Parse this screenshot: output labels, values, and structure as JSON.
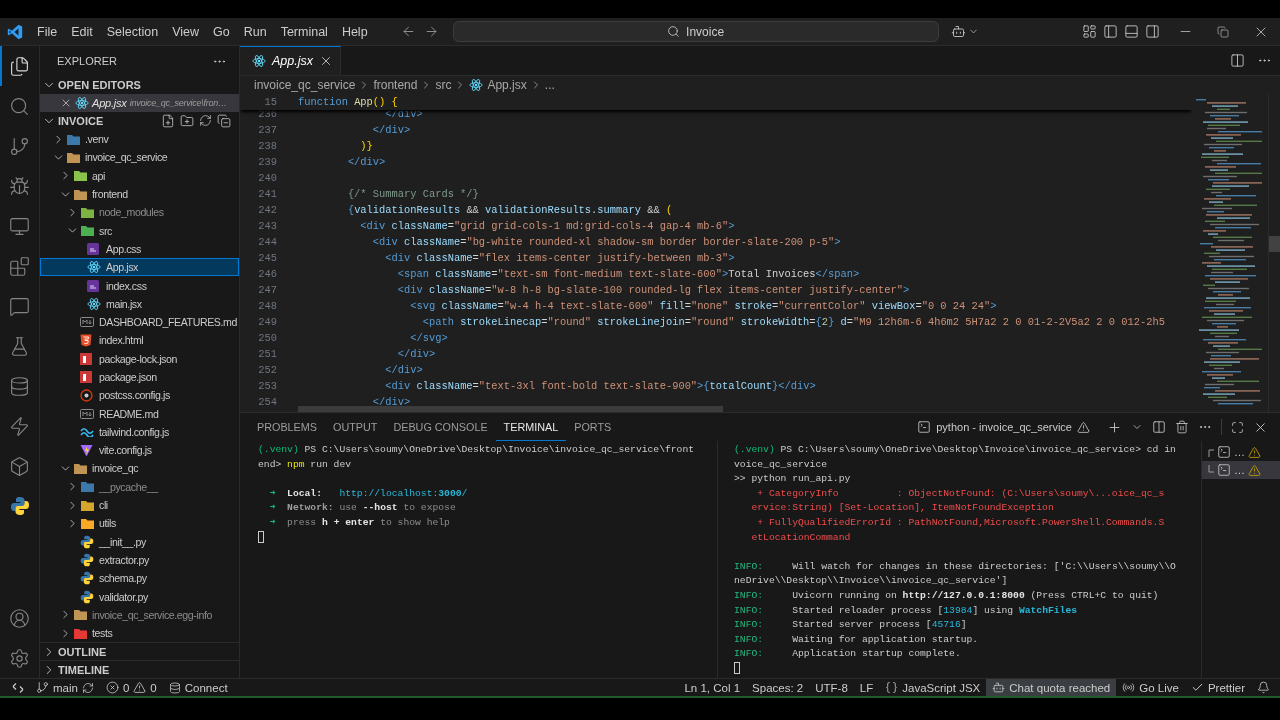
{
  "title_bar": {
    "menu": [
      "File",
      "Edit",
      "Selection",
      "View",
      "Go",
      "Run",
      "Terminal",
      "Help"
    ],
    "search": "Invoice"
  },
  "activity_bar": {
    "items": [
      {
        "kind": "explorer",
        "selected": true
      },
      {
        "kind": "search",
        "selected": false
      },
      {
        "kind": "source-control",
        "selected": false
      },
      {
        "kind": "run-debug",
        "selected": false
      },
      {
        "kind": "remote",
        "selected": false
      },
      {
        "kind": "extensions",
        "selected": false
      },
      {
        "kind": "chat",
        "selected": false
      },
      {
        "kind": "testing",
        "selected": false
      },
      {
        "kind": "database",
        "selected": false
      },
      {
        "kind": "lightning",
        "selected": false
      },
      {
        "kind": "package",
        "selected": false
      },
      {
        "kind": "python",
        "selected": false
      }
    ],
    "bottom": [
      {
        "kind": "account",
        "selected": false
      },
      {
        "kind": "settings",
        "selected": false
      }
    ]
  },
  "sidebar": {
    "title": "EXPLORER",
    "open_editors": {
      "title": "OPEN EDITORS",
      "expanded": true,
      "items": [
        {
          "name": "App.jsx",
          "description": "invoice_qc_service\\fron…",
          "kind": "react",
          "selected": true
        }
      ]
    },
    "workspace": {
      "title": "INVOICE",
      "expanded": true,
      "tree": [
        {
          "name": ".venv",
          "kind": "folder-python",
          "expanded": false,
          "selected": false,
          "ignored": false
        },
        {
          "name": "invoice_qc_service",
          "kind": "folder",
          "expanded": true,
          "selected": false,
          "ignored": false,
          "children": [
            {
              "name": "api",
              "kind": "folder-api",
              "expanded": false,
              "selected": false,
              "ignored": false
            },
            {
              "name": "frontend",
              "kind": "folder",
              "expanded": true,
              "selected": false,
              "ignored": false,
              "children": [
                {
                  "name": "node_modules",
                  "kind": "folder-node",
                  "expanded": false,
                  "selected": false,
                  "ignored": true
                },
                {
                  "name": "src",
                  "kind": "folder-src",
                  "expanded": true,
                  "selected": false,
                  "ignored": false,
                  "children": [
                    {
                      "name": "App.css",
                      "kind": "css",
                      "selected": false,
                      "ignored": false
                    },
                    {
                      "name": "App.jsx",
                      "kind": "react",
                      "selected": true,
                      "ignored": false
                    },
                    {
                      "name": "index.css",
                      "kind": "css",
                      "selected": false,
                      "ignored": false
                    },
                    {
                      "name": "main.jsx",
                      "kind": "react",
                      "selected": false,
                      "ignored": false
                    }
                  ]
                },
                {
                  "name": "DASHBOARD_FEATURES.md",
                  "kind": "markdown",
                  "selected": false,
                  "ignored": false
                },
                {
                  "name": "index.html",
                  "kind": "html",
                  "selected": false,
                  "ignored": false
                },
                {
                  "name": "package-lock.json",
                  "kind": "npm",
                  "selected": false,
                  "ignored": false
                },
                {
                  "name": "package.json",
                  "kind": "npm",
                  "selected": false,
                  "ignored": false
                },
                {
                  "name": "postcss.config.js",
                  "kind": "postcss",
                  "selected": false,
                  "ignored": false
                },
                {
                  "name": "README.md",
                  "kind": "markdown",
                  "selected": false,
                  "ignored": false
                },
                {
                  "name": "tailwind.config.js",
                  "kind": "tailwind",
                  "selected": false,
                  "ignored": false
                },
                {
                  "name": "vite.config.js",
                  "kind": "vite",
                  "selected": false,
                  "ignored": false
                }
              ]
            },
            {
              "name": "invoice_qc",
              "kind": "folder",
              "expanded": true,
              "selected": false,
              "ignored": false,
              "children": [
                {
                  "name": "__pycache__",
                  "kind": "folder-python",
                  "expanded": false,
                  "selected": false,
                  "ignored": true
                },
                {
                  "name": "cli",
                  "kind": "folder-cli",
                  "expanded": false,
                  "selected": false,
                  "ignored": false
                },
                {
                  "name": "utils",
                  "kind": "folder-utils",
                  "expanded": false,
                  "selected": false,
                  "ignored": false
                },
                {
                  "name": "__init__.py",
                  "kind": "python",
                  "selected": false,
                  "ignored": false
                },
                {
                  "name": "extractor.py",
                  "kind": "python",
                  "selected": false,
                  "ignored": false
                },
                {
                  "name": "schema.py",
                  "kind": "python",
                  "selected": false,
                  "ignored": false
                },
                {
                  "name": "validator.py",
                  "kind": "python",
                  "selected": false,
                  "ignored": false
                }
              ]
            },
            {
              "name": "invoice_qc_service.egg-info",
              "kind": "folder",
              "expanded": false,
              "selected": false,
              "ignored": true
            },
            {
              "name": "tests",
              "kind": "folder-test",
              "expanded": false,
              "selected": false,
              "ignored": false
            }
          ]
        }
      ]
    },
    "outline": {
      "title": "OUTLINE",
      "expanded": false
    },
    "timeline": {
      "title": "TIMELINE",
      "expanded": false
    }
  },
  "editor": {
    "tabs": [
      {
        "label": "App.jsx",
        "kind": "react",
        "selected": true,
        "preview": true
      }
    ],
    "breadcrumb": [
      {
        "label": "invoice_qc_service",
        "kind": "folder"
      },
      {
        "label": "frontend",
        "kind": "folder"
      },
      {
        "label": "src",
        "kind": "folder"
      },
      {
        "label": "App.jsx",
        "kind": "react"
      },
      {
        "label": "...",
        "kind": "symbol"
      }
    ],
    "sticky_line": {
      "number": "15",
      "tokens": [
        {
          "text": "function ",
          "kind": "keyword"
        },
        {
          "text": "App",
          "kind": "function"
        },
        {
          "text": "() {",
          "kind": "bracket"
        }
      ]
    },
    "lines": [
      {
        "number": "236",
        "tokens": [
          {
            "text": "              </div>",
            "kind": "tag"
          }
        ]
      },
      {
        "number": "237",
        "tokens": [
          {
            "text": "            </div>",
            "kind": "tag"
          }
        ]
      },
      {
        "number": "238",
        "tokens": [
          {
            "text": "          )}",
            "kind": "bracket"
          }
        ]
      },
      {
        "number": "239",
        "tokens": [
          {
            "text": "        </div>",
            "kind": "tag"
          }
        ]
      },
      {
        "number": "240"
      },
      {
        "number": "241",
        "tokens": [
          {
            "text": "        {/* Summary Cards */}",
            "kind": "comment"
          }
        ]
      },
      {
        "number": "242",
        "tokens": [
          {
            "text": "        {",
            "kind": "brace"
          },
          {
            "text": "validationResults",
            "kind": "variable"
          },
          {
            "text": " && ",
            "kind": "text"
          },
          {
            "text": "validationResults",
            "kind": "variable"
          },
          {
            "text": ".",
            "kind": "text"
          },
          {
            "text": "summary",
            "kind": "variable"
          },
          {
            "text": " && ",
            "kind": "text"
          },
          {
            "text": "(",
            "kind": "bracket"
          }
        ]
      },
      {
        "number": "243",
        "tokens": [
          {
            "text": "          <div",
            "kind": "tag"
          },
          {
            "text": " className",
            "kind": "attr"
          },
          {
            "text": "=",
            "kind": "text"
          },
          {
            "text": "\"grid grid-cols-1 md:grid-cols-4 gap-4 mb-6\"",
            "kind": "string"
          },
          {
            "text": ">",
            "kind": "tag"
          }
        ]
      },
      {
        "number": "244",
        "tokens": [
          {
            "text": "            <div",
            "kind": "tag"
          },
          {
            "text": " className",
            "kind": "attr"
          },
          {
            "text": "=",
            "kind": "text"
          },
          {
            "text": "\"bg-white rounded-xl shadow-sm border border-slate-200 p-5\"",
            "kind": "string"
          },
          {
            "text": ">",
            "kind": "tag"
          }
        ]
      },
      {
        "number": "245",
        "tokens": [
          {
            "text": "              <div",
            "kind": "tag"
          },
          {
            "text": " className",
            "kind": "attr"
          },
          {
            "text": "=",
            "kind": "text"
          },
          {
            "text": "\"flex items-center justify-between mb-3\"",
            "kind": "string"
          },
          {
            "text": ">",
            "kind": "tag"
          }
        ]
      },
      {
        "number": "246",
        "tokens": [
          {
            "text": "                <span",
            "kind": "tag"
          },
          {
            "text": " className",
            "kind": "attr"
          },
          {
            "text": "=",
            "kind": "text"
          },
          {
            "text": "\"text-sm font-medium text-slate-600\"",
            "kind": "string"
          },
          {
            "text": ">",
            "kind": "tag"
          },
          {
            "text": "Total Invoices",
            "kind": "text"
          },
          {
            "text": "</span>",
            "kind": "tag"
          }
        ]
      },
      {
        "number": "247",
        "tokens": [
          {
            "text": "                <div",
            "kind": "tag"
          },
          {
            "text": " className",
            "kind": "attr"
          },
          {
            "text": "=",
            "kind": "text"
          },
          {
            "text": "\"w-8 h-8 bg-slate-100 rounded-lg flex items-center justify-center\"",
            "kind": "string"
          },
          {
            "text": ">",
            "kind": "tag"
          }
        ]
      },
      {
        "number": "248",
        "tokens": [
          {
            "text": "                  <svg",
            "kind": "tag"
          },
          {
            "text": " className",
            "kind": "attr"
          },
          {
            "text": "=",
            "kind": "text"
          },
          {
            "text": "\"w-4 h-4 text-slate-600\"",
            "kind": "string"
          },
          {
            "text": " fill",
            "kind": "attr"
          },
          {
            "text": "=",
            "kind": "text"
          },
          {
            "text": "\"none\"",
            "kind": "string"
          },
          {
            "text": " stroke",
            "kind": "attr"
          },
          {
            "text": "=",
            "kind": "text"
          },
          {
            "text": "\"currentColor\"",
            "kind": "string"
          },
          {
            "text": " viewBox",
            "kind": "attr"
          },
          {
            "text": "=",
            "kind": "text"
          },
          {
            "text": "\"0 0 24 24\"",
            "kind": "string"
          },
          {
            "text": ">",
            "kind": "tag"
          }
        ]
      },
      {
        "number": "249",
        "tokens": [
          {
            "text": "                    <path",
            "kind": "tag"
          },
          {
            "text": " strokeLinecap",
            "kind": "attr"
          },
          {
            "text": "=",
            "kind": "text"
          },
          {
            "text": "\"round\"",
            "kind": "string"
          },
          {
            "text": " strokeLinejoin",
            "kind": "attr"
          },
          {
            "text": "=",
            "kind": "text"
          },
          {
            "text": "\"round\"",
            "kind": "string"
          },
          {
            "text": " strokeWidth",
            "kind": "attr"
          },
          {
            "text": "=",
            "kind": "text"
          },
          {
            "text": "{",
            "kind": "brace"
          },
          {
            "text": "2",
            "kind": "number"
          },
          {
            "text": "}",
            "kind": "brace"
          },
          {
            "text": " d",
            "kind": "attr"
          },
          {
            "text": "=",
            "kind": "text"
          },
          {
            "text": "\"M9 12h6m-6 4h6m2 5H7a2 2 0 01-2-2V5a2 2 0 012-2h5",
            "kind": "string"
          }
        ]
      },
      {
        "number": "250",
        "tokens": [
          {
            "text": "                  </svg>",
            "kind": "tag"
          }
        ]
      },
      {
        "number": "251",
        "tokens": [
          {
            "text": "                </div>",
            "kind": "tag"
          }
        ]
      },
      {
        "number": "252",
        "tokens": [
          {
            "text": "              </div>",
            "kind": "tag"
          }
        ]
      },
      {
        "number": "253",
        "tokens": [
          {
            "text": "              <div",
            "kind": "tag"
          },
          {
            "text": " className",
            "kind": "attr"
          },
          {
            "text": "=",
            "kind": "text"
          },
          {
            "text": "\"text-3xl font-bold text-slate-900\"",
            "kind": "string"
          },
          {
            "text": ">",
            "kind": "tag"
          },
          {
            "text": "{",
            "kind": "brace"
          },
          {
            "text": "totalCount",
            "kind": "variable"
          },
          {
            "text": "}",
            "kind": "brace"
          },
          {
            "text": "</div>",
            "kind": "tag"
          }
        ]
      },
      {
        "number": "254",
        "tokens": [
          {
            "text": "            </div>",
            "kind": "tag"
          }
        ]
      }
    ]
  },
  "panel": {
    "tabs": [
      {
        "label": "PROBLEMS",
        "selected": false
      },
      {
        "label": "OUTPUT",
        "selected": false
      },
      {
        "label": "DEBUG CONSOLE",
        "selected": false
      },
      {
        "label": "TERMINAL",
        "selected": true
      },
      {
        "label": "PORTS",
        "selected": false
      }
    ],
    "terminal_name": "python - invoice_qc_service",
    "left_terminal": [
      {
        "kind": "text",
        "segments": [
          {
            "text": "(.venv)",
            "kind": "env"
          },
          {
            "text": " PS C:\\Users\\soumy\\OneDrive\\Desktop\\Invoice\\invoice_qc_service\\front",
            "kind": "plain"
          }
        ]
      },
      {
        "kind": "text",
        "segments": [
          {
            "text": "end> ",
            "kind": "plain"
          },
          {
            "text": "npm",
            "kind": "command"
          },
          {
            "text": " run dev",
            "kind": "plain"
          }
        ]
      },
      {
        "kind": "blank"
      },
      {
        "kind": "text",
        "segments": [
          {
            "text": "  ➜  ",
            "kind": "arrow"
          },
          {
            "text": "Local:",
            "kind": "strong"
          },
          {
            "text": "   http://localhost:",
            "kind": "link"
          },
          {
            "text": "3000",
            "kind": "link-strong"
          },
          {
            "text": "/",
            "kind": "link"
          }
        ]
      },
      {
        "kind": "text",
        "segments": [
          {
            "text": "  ➜  ",
            "kind": "arrow"
          },
          {
            "text": "Network:",
            "kind": "muted-strong"
          },
          {
            "text": " use ",
            "kind": "muted"
          },
          {
            "text": "--host",
            "kind": "strong"
          },
          {
            "text": " to expose",
            "kind": "muted"
          }
        ]
      },
      {
        "kind": "text",
        "segments": [
          {
            "text": "  ➜  ",
            "kind": "arrow"
          },
          {
            "text": "press ",
            "kind": "muted"
          },
          {
            "text": "h",
            "kind": "strong"
          },
          {
            "text": " + ",
            "kind": "strong"
          },
          {
            "text": "enter",
            "kind": "strong"
          },
          {
            "text": " to show help",
            "kind": "muted"
          }
        ]
      },
      {
        "kind": "cursor"
      }
    ],
    "right_terminal": [
      {
        "kind": "text",
        "segments": [
          {
            "text": "(.venv)",
            "kind": "env"
          },
          {
            "text": " PS C:\\Users\\soumy\\OneDrive\\Desktop\\Invoice\\invoice_qc_service> cd in",
            "kind": "plain"
          }
        ]
      },
      {
        "kind": "text",
        "segments": [
          {
            "text": "voice_qc_service",
            "kind": "plain"
          }
        ]
      },
      {
        "kind": "text",
        "segments": [
          {
            "text": ">> python run_api.py",
            "kind": "plain"
          }
        ]
      },
      {
        "kind": "text",
        "segments": [
          {
            "text": "    + CategoryInfo          : ObjectNotFound: (C:\\Users\\soumy\\...oice_qc_s",
            "kind": "error"
          }
        ]
      },
      {
        "kind": "text",
        "segments": [
          {
            "text": "   ervice:String) [Set-Location], ItemNotFoundException",
            "kind": "error"
          }
        ]
      },
      {
        "kind": "text",
        "segments": [
          {
            "text": "    + FullyQualifiedErrorId : PathNotFound,Microsoft.PowerShell.Commands.S",
            "kind": "error"
          }
        ]
      },
      {
        "kind": "text",
        "segments": [
          {
            "text": "   etLocationCommand",
            "kind": "error"
          }
        ]
      },
      {
        "kind": "blank"
      },
      {
        "kind": "text",
        "segments": [
          {
            "text": "INFO:",
            "kind": "level"
          },
          {
            "text": "     Will watch for changes in these directories: ['C:\\\\Users\\\\soumy\\\\O",
            "kind": "plain"
          }
        ]
      },
      {
        "kind": "text",
        "segments": [
          {
            "text": "neDrive\\\\Desktop\\\\Invoice\\\\invoice_qc_service']",
            "kind": "plain"
          }
        ]
      },
      {
        "kind": "text",
        "segments": [
          {
            "text": "INFO:",
            "kind": "level"
          },
          {
            "text": "     Uvicorn running on ",
            "kind": "plain"
          },
          {
            "text": "http://127.0.0.1:8000",
            "kind": "url-strong"
          },
          {
            "text": " (Press CTRL+C to quit)",
            "kind": "plain"
          }
        ]
      },
      {
        "kind": "text",
        "segments": [
          {
            "text": "INFO:",
            "kind": "level"
          },
          {
            "text": "     Started reloader process [",
            "kind": "plain"
          },
          {
            "text": "13984",
            "kind": "number"
          },
          {
            "text": "] using ",
            "kind": "plain"
          },
          {
            "text": "WatchFiles",
            "kind": "highlight"
          }
        ]
      },
      {
        "kind": "text",
        "segments": [
          {
            "text": "INFO:",
            "kind": "level"
          },
          {
            "text": "     Started server process [",
            "kind": "plain"
          },
          {
            "text": "45716",
            "kind": "number"
          },
          {
            "text": "]",
            "kind": "plain"
          }
        ]
      },
      {
        "kind": "text",
        "segments": [
          {
            "text": "INFO:",
            "kind": "level"
          },
          {
            "text": "     Waiting for application startup.",
            "kind": "plain"
          }
        ]
      },
      {
        "kind": "text",
        "segments": [
          {
            "text": "INFO:",
            "kind": "level"
          },
          {
            "text": "     Application startup complete.",
            "kind": "plain"
          }
        ]
      },
      {
        "kind": "cursor"
      }
    ],
    "terminal_list": [
      {
        "label": "…",
        "selected": false
      },
      {
        "label": "…",
        "selected": true
      }
    ]
  },
  "status_bar": {
    "branch": "main",
    "errors": "0",
    "warnings": "0",
    "connect": "Connect",
    "position": "Ln 1, Col 1",
    "indentation": "Spaces: 2",
    "encoding": "UTF-8",
    "eol": "LF",
    "language": "JavaScript JSX",
    "chat": {
      "label": "Chat quota reached",
      "warning": true
    },
    "live": "Go Live",
    "formatter": "Prettier"
  }
}
